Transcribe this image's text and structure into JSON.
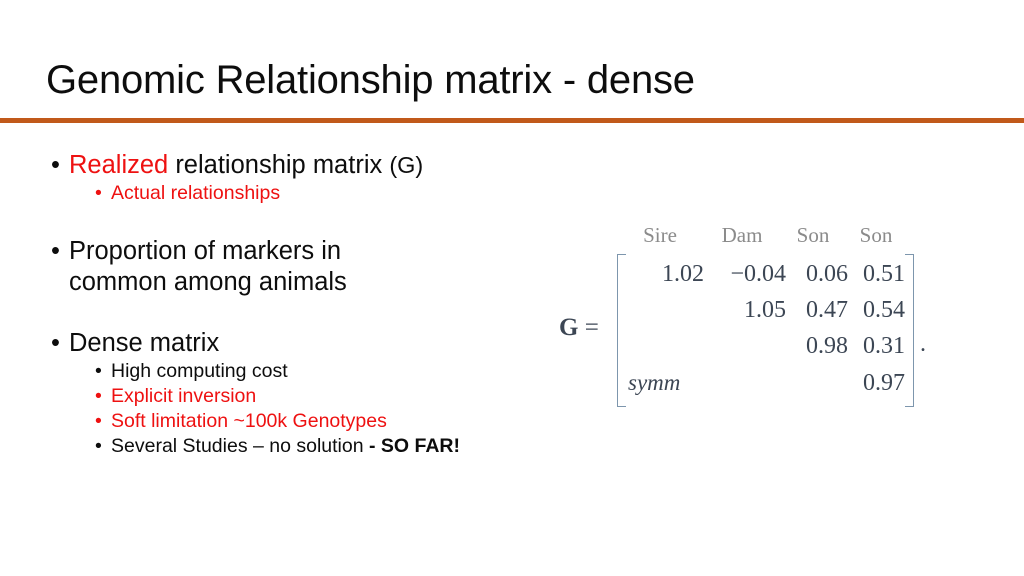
{
  "slide": {
    "title": "Genomic Relationship matrix - dense",
    "accent_color": "#c1591a",
    "highlight_color": "#ee1111",
    "text_color": "#0d0d0d",
    "background_color": "#ffffff"
  },
  "bullets": {
    "b1_red": "Realized",
    "b1_rest": " relationship matrix ",
    "b1_paren": "(G)",
    "b1_sub": "Actual relationships",
    "b2_line1": "Proportion of markers in",
    "b2_line2": "common among animals",
    "b3": "Dense matrix",
    "b3_sub1": "High computing cost",
    "b3_sub2": "Explicit inversion",
    "b3_sub3": "Soft limitation ~100k Genotypes",
    "b3_sub4_normal": "Several Studies – no solution ",
    "b3_sub4_bold": "- SO FAR!",
    "marker": "•"
  },
  "matrix": {
    "lhs_symbol": "G",
    "equals": " =",
    "headers": [
      "Sire",
      "Dam",
      "Son",
      "Son"
    ],
    "rows": [
      [
        "1.02",
        "−0.04",
        "0.06",
        "0.51"
      ],
      [
        "",
        "1.05",
        "0.47",
        "0.54"
      ],
      [
        "",
        "",
        "0.98",
        "0.31"
      ],
      [
        "",
        "",
        "",
        "0.97"
      ]
    ],
    "lower_triangle_label": "symm",
    "trailing_punctuation": ".",
    "value_color": "#3c4654",
    "header_color": "#8b8b8b",
    "bracket_color": "#7d96ad"
  }
}
